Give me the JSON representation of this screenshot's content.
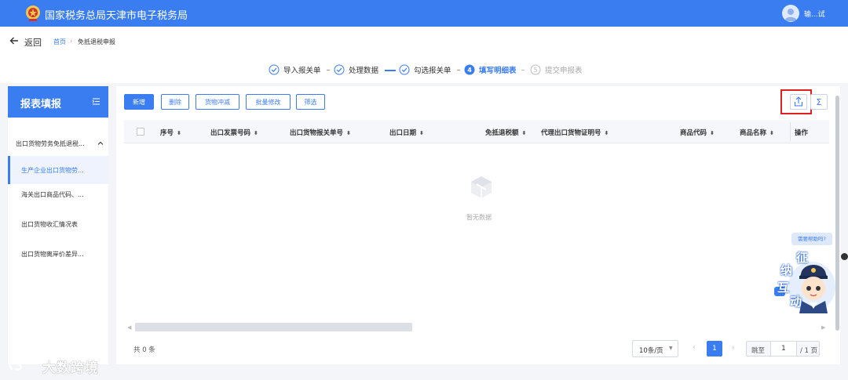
{
  "header": {
    "brand": "国家税务总局天津市电子税务局",
    "user_name": "输...试"
  },
  "nav": {
    "back_label": "返回",
    "breadcrumb_home": "首页",
    "breadcrumb_sep": "›",
    "breadcrumb_current": "免抵退税申报"
  },
  "steps": [
    {
      "label": "导入报关单",
      "state": "done"
    },
    {
      "label": "处理数据",
      "state": "done"
    },
    {
      "label": "勾选报关单",
      "state": "done"
    },
    {
      "label": "填写明细表",
      "state": "active",
      "num": "4"
    },
    {
      "label": "提交申报表",
      "state": "todo",
      "num": "5"
    }
  ],
  "sidebar": {
    "title": "报表填报",
    "group_label": "出口货物劳务免抵退税...",
    "items": [
      {
        "label": "生产企业出口货物劳...",
        "active": true
      },
      {
        "label": "海关出口商品代码、...",
        "active": false
      },
      {
        "label": "出口货物收汇情况表",
        "active": false
      },
      {
        "label": "出口货物离岸价差异...",
        "active": false
      }
    ]
  },
  "toolbar": {
    "add": "新增",
    "delete": "删除",
    "reduce": "货物冲减",
    "batch_edit": "批量修改",
    "filter": "筛选",
    "sum_symbol": "Σ"
  },
  "table": {
    "columns": [
      "序号",
      "出口发票号码",
      "出口货物报关单号",
      "出口日期",
      "免抵退税额",
      "代理出口货物证明号",
      "商品代码",
      "商品名称",
      "操作"
    ],
    "sort_glyph": "⬍",
    "empty_text": "暂无数据"
  },
  "pagination": {
    "total_text": "共 0 条",
    "page_size": "10条/页",
    "prev": "‹",
    "current_page": "1",
    "next": "›",
    "jump_label": "跳至",
    "jump_value": "1",
    "total_pages": "/ 1 页"
  },
  "help": {
    "bubble": "需要帮助吗?",
    "chars": [
      "征",
      "纳",
      "互",
      "动"
    ]
  },
  "watermark": {
    "text": "大数跨境"
  },
  "colors": {
    "primary": "#3a7df0",
    "highlight_box": "#e02020"
  }
}
